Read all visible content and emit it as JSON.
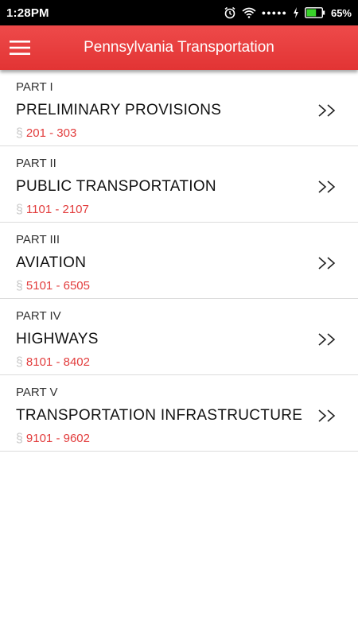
{
  "status_bar": {
    "time": "1:28PM",
    "battery_percent": "65%",
    "battery_level": 0.65,
    "signal_dots": "●●●●●",
    "icons": [
      "alarm-icon",
      "wifi-icon",
      "signal-icon",
      "charging-icon",
      "battery-icon"
    ]
  },
  "app_bar": {
    "title": "Pennsylvania Transportation",
    "menu_icon": "hamburger-menu-icon",
    "color": "#e53c3c"
  },
  "parts": [
    {
      "part": "PART I",
      "title": "PRELIMINARY PROVISIONS",
      "symbol": "§",
      "range": "201 - 303",
      "chevron": ">>"
    },
    {
      "part": "PART II",
      "title": "PUBLIC TRANSPORTATION",
      "symbol": "§",
      "range": "1101 - 2107",
      "chevron": ">>"
    },
    {
      "part": "PART III",
      "title": "AVIATION",
      "symbol": "§",
      "range": "5101 - 6505",
      "chevron": ">>"
    },
    {
      "part": "PART IV",
      "title": "HIGHWAYS",
      "symbol": "§",
      "range": "8101 - 8402",
      "chevron": ">>"
    },
    {
      "part": "PART V",
      "title": "TRANSPORTATION INFRASTRUCTURE",
      "symbol": "§",
      "range": "9101 - 9602",
      "chevron": ">>"
    }
  ],
  "colors": {
    "accent": "#e53c3c",
    "range_text": "#e23c3c",
    "divider": "#dcdcdc"
  }
}
